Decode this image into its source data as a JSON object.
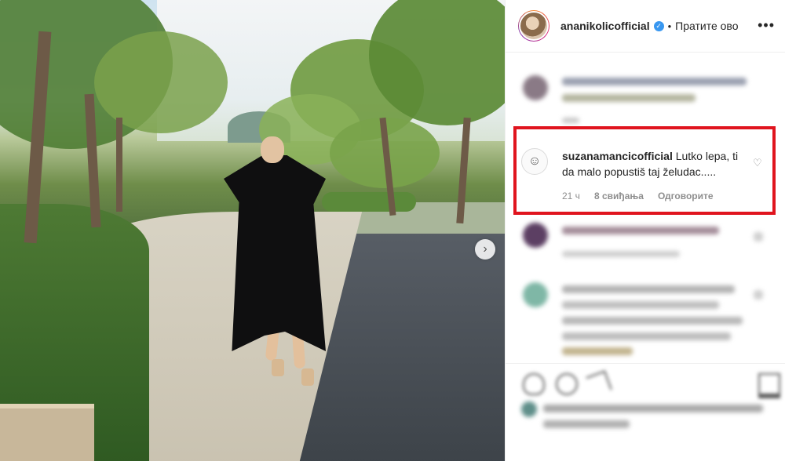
{
  "post": {
    "username": "ananikolicofficial",
    "follow_label": "Пратите ово",
    "separator": "•",
    "more_label": "•••",
    "next_label": "›"
  },
  "highlighted_comment": {
    "username": "suzanamancicofficial",
    "text": "Lutko lepa, ti da malo popustiš taj želudac.....",
    "time": "21 ч",
    "likes": "8 свиђања",
    "reply_label": "Одговорите",
    "heart_label": "♡",
    "avatar_glyph": "☺"
  },
  "colors": {
    "highlight": "#e0141e",
    "verified": "#3897f0",
    "meta_text": "#8e8e8e"
  },
  "icons": [
    "heart-icon",
    "comment-icon",
    "share-icon",
    "save-icon",
    "verified-badge-icon",
    "chevron-right-icon",
    "more-icon"
  ]
}
